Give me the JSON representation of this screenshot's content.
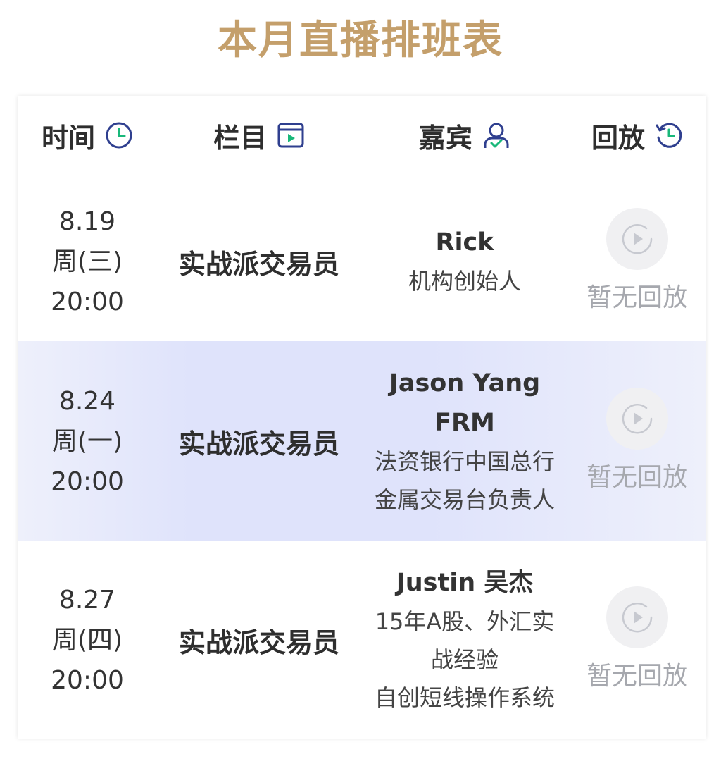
{
  "page_title": "本月直播排班表",
  "header": {
    "time": "时间",
    "column": "栏目",
    "guest": "嘉宾",
    "replay": "回放"
  },
  "rows": [
    {
      "date": "8.19",
      "weekday": "周(三)",
      "time": "20:00",
      "column": "实战派交易员",
      "guest_name_lines": [
        "Rick"
      ],
      "guest_desc_lines": [
        "机构创始人"
      ],
      "replay": "暂无回放"
    },
    {
      "date": "8.24",
      "weekday": "周(一)",
      "time": "20:00",
      "column": "实战派交易员",
      "guest_name_lines": [
        "Jason Yang",
        "FRM"
      ],
      "guest_desc_lines": [
        "法资银行中国总行",
        "金属交易台负责人"
      ],
      "replay": "暂无回放"
    },
    {
      "date": "8.27",
      "weekday": "周(四)",
      "time": "20:00",
      "column": "实战派交易员",
      "guest_name_lines": [
        "Justin 吴杰"
      ],
      "guest_desc_lines": [
        "15年A股、外汇实",
        "战经验",
        "自创短线操作系统"
      ],
      "replay": "暂无回放"
    }
  ],
  "colors": {
    "title": "#c49f6b",
    "icon_blue": "#2f3f8f",
    "icon_green": "#19b87a",
    "highlight_row": "#dfe3fb"
  },
  "icons": {
    "time": "clock-icon",
    "column": "video-play-icon",
    "guest": "user-icon",
    "replay": "history-icon",
    "replay_button": "play-circle-icon"
  }
}
